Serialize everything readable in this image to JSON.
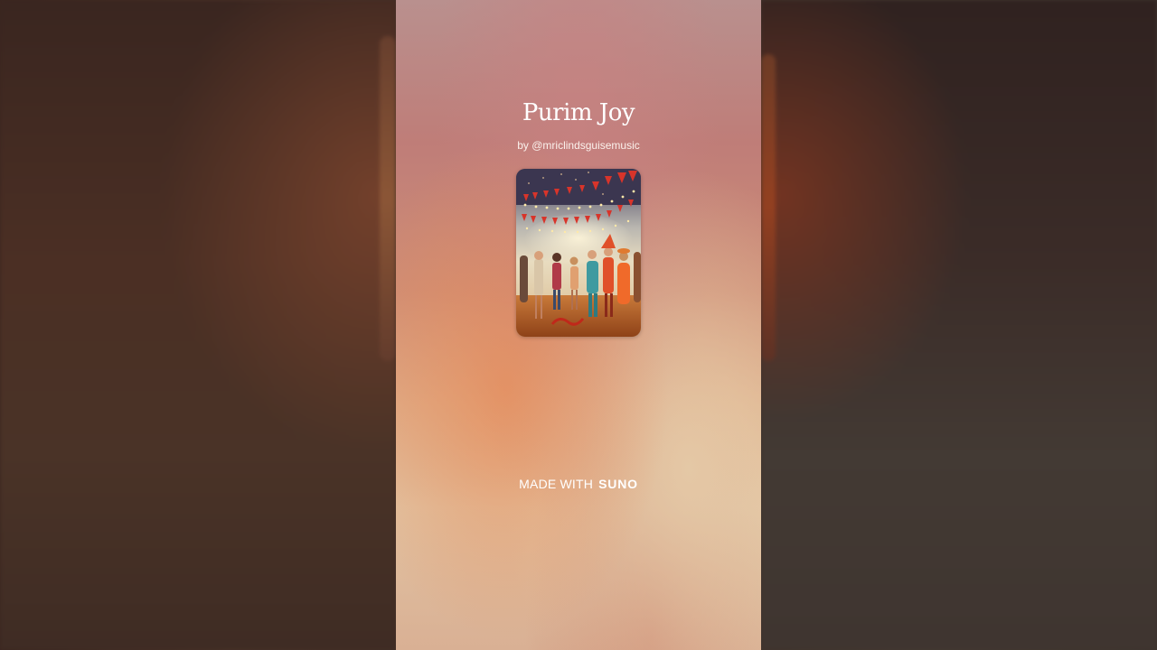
{
  "song": {
    "title": "Purim Joy",
    "byline": "by @mriclindsguisemusic"
  },
  "cover_art": {
    "description": "festive Purim party scene artwork"
  },
  "footer": {
    "made_with": "MADE WITH",
    "brand": "SUNO"
  }
}
